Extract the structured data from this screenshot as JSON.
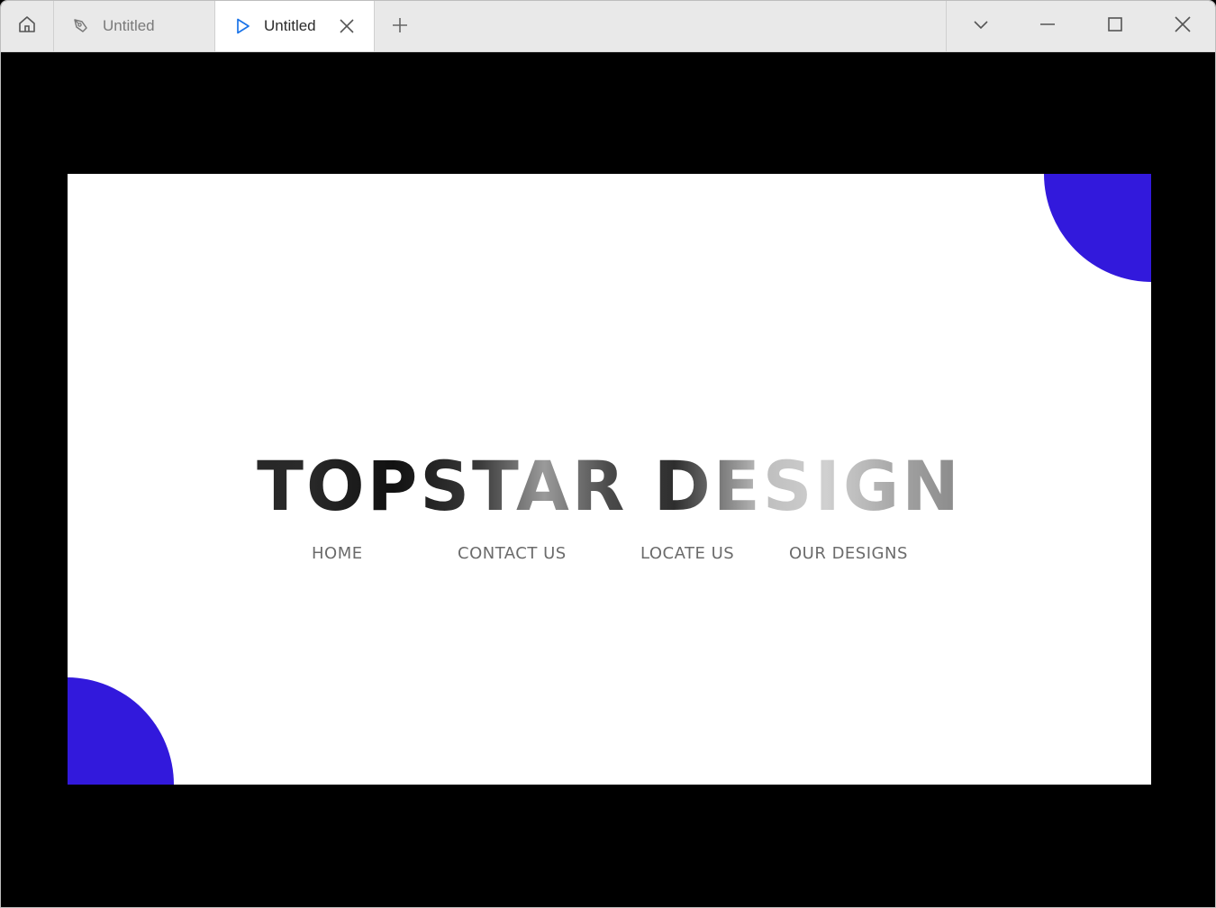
{
  "titlebar": {
    "home_icon": "home-icon",
    "tabs": [
      {
        "label": "Untitled",
        "icon": "pen-tool-icon",
        "active": false
      },
      {
        "label": "Untitled",
        "icon": "play-icon",
        "active": true,
        "close_icon": "close-icon"
      }
    ],
    "new_tab_icon": "plus-icon",
    "window_controls": [
      "chevron-down-icon",
      "minimize-icon",
      "maximize-icon",
      "close-icon"
    ]
  },
  "artboard": {
    "title": "TOPSTAR DESIGN",
    "nav": {
      "home": "HOME",
      "contact": "CONTACT US",
      "locate": "LOCATE US",
      "designs": "OUR DESIGNS"
    },
    "accent_color": "#3219dc",
    "background_color": "#ffffff"
  },
  "colors": {
    "canvas": "#000000",
    "titlebar": "#e9e9e9",
    "active_tab": "#ffffff",
    "play_icon": "#1a73e8"
  }
}
